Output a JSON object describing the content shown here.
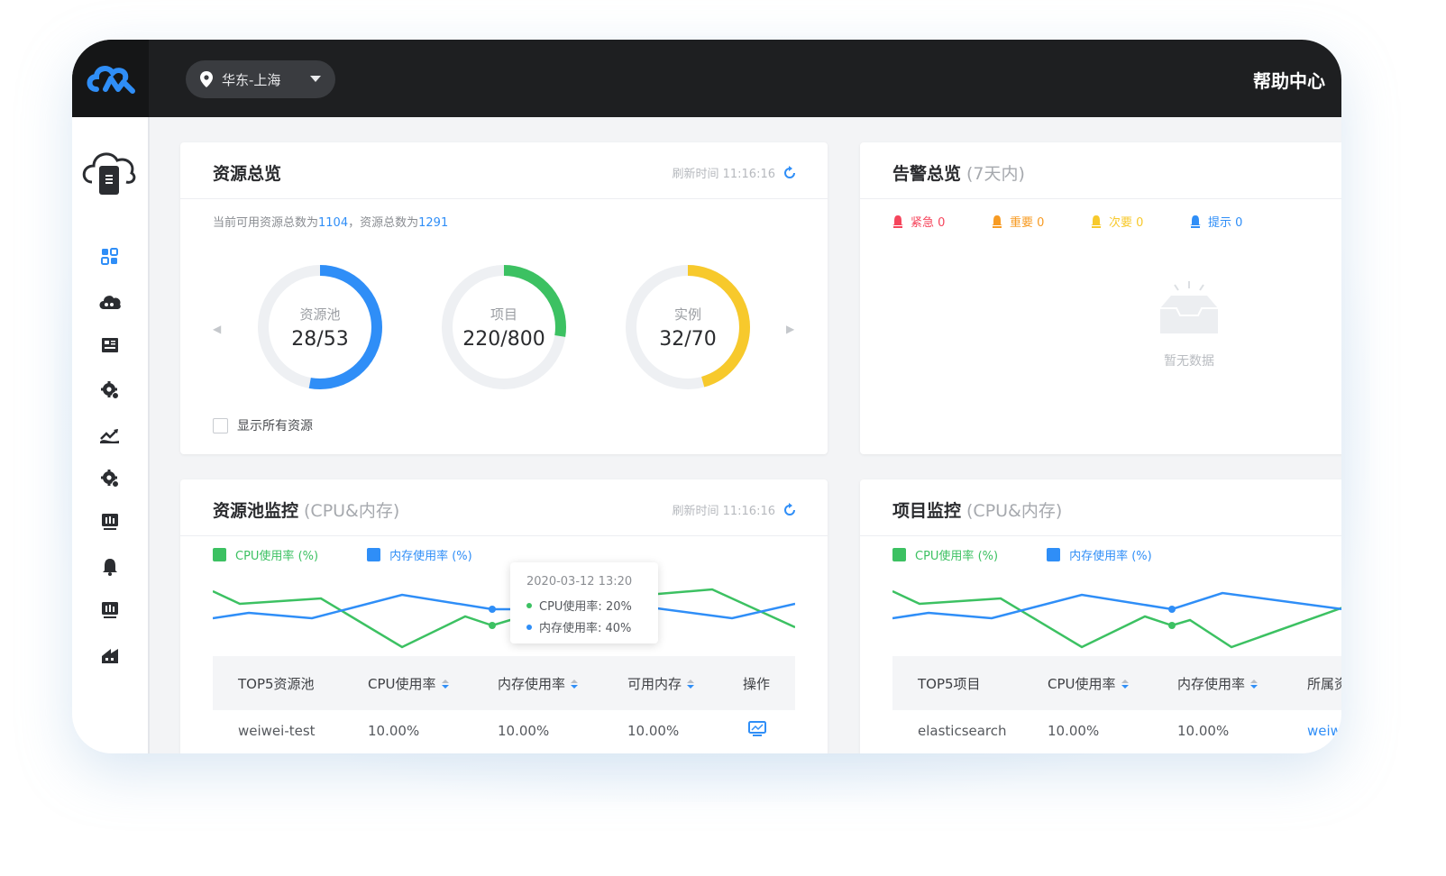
{
  "topbar": {
    "region_label": "华东-上海",
    "help_label": "帮助中心"
  },
  "sidebar": {
    "items": [
      "dashboard-icon",
      "cloud-icon",
      "server-icon",
      "gear-icon",
      "chart-icon",
      "settings-icon",
      "monitor-icon",
      "bell-icon",
      "monitor-icon",
      "network-icon"
    ]
  },
  "resource_overview": {
    "title": "资源总览",
    "refresh_label": "刷新时间 11:16:16",
    "summary_prefix": "当前可用资源总数为",
    "available_total": "1104",
    "summary_mid": "，资源总数为",
    "total": "1291",
    "rings": [
      {
        "label": "资源池",
        "value_text": "28/53",
        "used": 28,
        "total": 53,
        "color": "#2f8ef7"
      },
      {
        "label": "项目",
        "value_text": "220/800",
        "used": 220,
        "total": 800,
        "color": "#3cc162"
      },
      {
        "label": "实例",
        "value_text": "32/70",
        "used": 32,
        "total": 70,
        "color": "#f7c92c"
      }
    ],
    "show_all_label": "显示所有资源"
  },
  "alert_overview": {
    "title": "告警总览",
    "subtitle": "(7天内)",
    "levels": [
      {
        "label": "紧急 0",
        "color": "#f5455c"
      },
      {
        "label": "重要 0",
        "color": "#f79b23"
      },
      {
        "label": "次要 0",
        "color": "#f7c92c"
      },
      {
        "label": "提示 0",
        "color": "#2f8ef7"
      }
    ],
    "empty_text": "暂无数据"
  },
  "pool_monitor": {
    "title": "资源池监控",
    "subtitle": "(CPU&内存)",
    "refresh_label": "刷新时间 11:16:16",
    "legend_cpu": "CPU使用率 (%)",
    "legend_mem": "内存使用率 (%)",
    "tooltip_time": "2020-03-12 13:20",
    "tooltip_cpu": "CPU使用率: 20%",
    "tooltip_mem": "内存使用率: 40%",
    "columns": [
      "TOP5资源池",
      "CPU使用率",
      "内存使用率",
      "可用内存",
      "操作"
    ],
    "rows": [
      {
        "name": "weiwei-test",
        "cpu": "10.00%",
        "mem": "10.00%",
        "avail": "10.00%"
      }
    ]
  },
  "project_monitor": {
    "title": "项目监控",
    "subtitle": "(CPU&内存)",
    "legend_cpu": "CPU使用率 (%)",
    "legend_mem": "内存使用率 (%)",
    "columns": [
      "TOP5项目",
      "CPU使用率",
      "内存使用率",
      "所属资"
    ],
    "rows": [
      {
        "name": "elasticsearch",
        "cpu": "10.00%",
        "mem": "10.00%",
        "pool": "weiw"
      }
    ]
  },
  "colors": {
    "cpu": "#3cc162",
    "mem": "#2f8ef7"
  }
}
